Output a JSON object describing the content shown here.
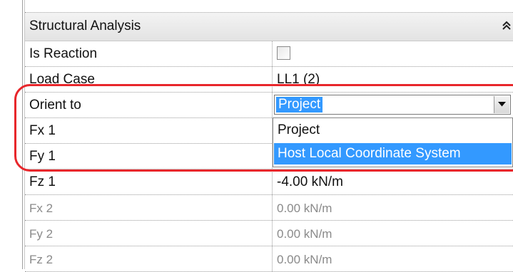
{
  "section": {
    "title": "Structural Analysis",
    "collapse_icon": "double-chevron-up-icon"
  },
  "rows": [
    {
      "label": "Is Reaction",
      "value": "",
      "kind": "checkbox",
      "checked": false
    },
    {
      "label": "Load Case",
      "value": "LL1 (2)",
      "kind": "text"
    },
    {
      "label": "Orient to",
      "value": "Project",
      "kind": "combo"
    },
    {
      "label": "Fx 1",
      "value": "",
      "kind": "text"
    },
    {
      "label": "Fy 1",
      "value": "",
      "kind": "text"
    },
    {
      "label": "Fz 1",
      "value": "-4.00 kN/m",
      "kind": "text"
    },
    {
      "label": "Fx 2",
      "value": "0.00 kN/m",
      "kind": "text",
      "disabled": true
    },
    {
      "label": "Fy 2",
      "value": "0.00 kN/m",
      "kind": "text",
      "disabled": true
    },
    {
      "label": "Fz 2",
      "value": "0.00 kN/m",
      "kind": "text",
      "disabled": true
    }
  ],
  "orient_dropdown": {
    "selected": "Project",
    "options": [
      "Project",
      "Host Local Coordinate System"
    ],
    "highlighted_option": "Host Local Coordinate System"
  },
  "colors": {
    "selection": "#3399ff",
    "annotation_outline": "#e8262b"
  }
}
